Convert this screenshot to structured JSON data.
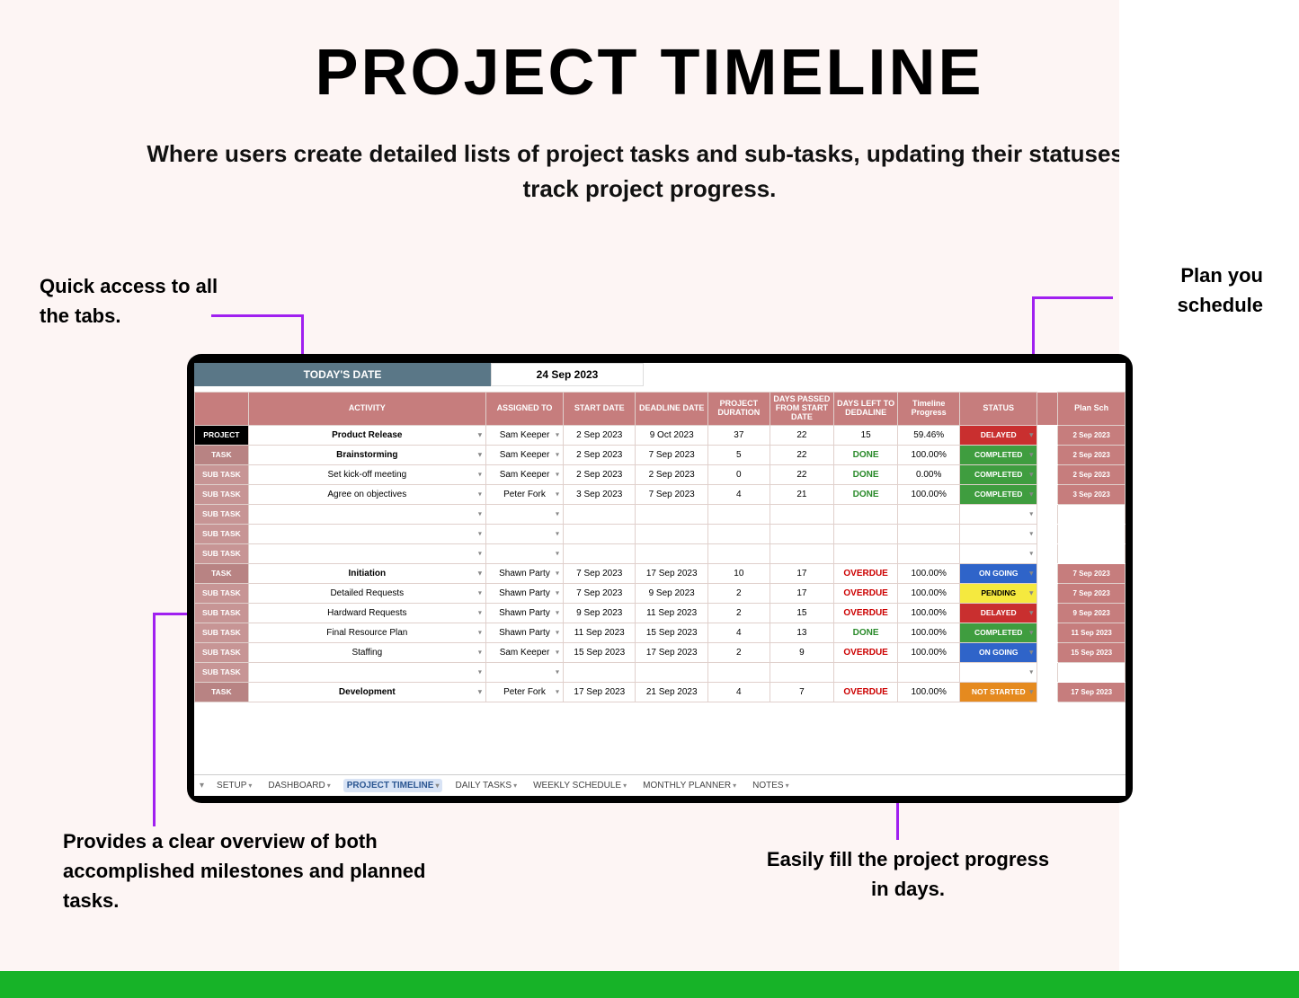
{
  "page_title": "PROJECT TIMELINE",
  "subtitle": "Where users create detailed lists of project tasks and sub-tasks, updating their statuses to track project progress.",
  "annotations": {
    "topleft": "Quick access to all the tabs.",
    "topright": "Plan you schedule",
    "bottomleft": "Provides a clear overview of both accomplished milestones and planned tasks.",
    "bottomright": "Easily fill the project progress in days."
  },
  "today_label": "TODAY'S DATE",
  "today_value": "24 Sep 2023",
  "columns": [
    "",
    "ACTIVITY",
    "ASSIGNED TO",
    "START DATE",
    "DEADLINE DATE",
    "PROJECT DURATION",
    "DAYS PASSED FROM START DATE",
    "DAYS LEFT TO DEDALINE",
    "Timeline Progress",
    "STATUS",
    "",
    "Plan Sch"
  ],
  "rows": [
    {
      "type": "PROJECT",
      "type_class": "rt-project",
      "bold": true,
      "activity": "Product Release",
      "assigned": "Sam Keeper",
      "start": "2 Sep 2023",
      "deadline": "9 Oct 2023",
      "duration": "37",
      "passed": "22",
      "left": "15",
      "left_class": "",
      "progress": "59.46%",
      "status": "DELAYED",
      "status_class": "st-delayed",
      "plan": "2 Sep 2023"
    },
    {
      "type": "TASK",
      "type_class": "rt-task",
      "bold": true,
      "activity": "Brainstorming",
      "assigned": "Sam Keeper",
      "start": "2 Sep 2023",
      "deadline": "7 Sep 2023",
      "duration": "5",
      "passed": "22",
      "left": "DONE",
      "left_class": "done",
      "progress": "100.00%",
      "status": "COMPLETED",
      "status_class": "st-completed",
      "plan": "2 Sep 2023"
    },
    {
      "type": "SUB TASK",
      "type_class": "rt-subtask",
      "activity": "Set kick-off meeting",
      "assigned": "Sam Keeper",
      "start": "2 Sep 2023",
      "deadline": "2 Sep 2023",
      "duration": "0",
      "passed": "22",
      "left": "DONE",
      "left_class": "done",
      "progress": "0.00%",
      "status": "COMPLETED",
      "status_class": "st-completed",
      "plan": "2 Sep 2023"
    },
    {
      "type": "SUB TASK",
      "type_class": "rt-subtask",
      "activity": "Agree on objectives",
      "assigned": "Peter Fork",
      "start": "3 Sep 2023",
      "deadline": "7 Sep 2023",
      "duration": "4",
      "passed": "21",
      "left": "DONE",
      "left_class": "done",
      "progress": "100.00%",
      "status": "COMPLETED",
      "status_class": "st-completed",
      "plan": "3 Sep 2023"
    },
    {
      "type": "SUB TASK",
      "type_class": "rt-subtask",
      "activity": "",
      "assigned": "",
      "start": "",
      "deadline": "",
      "duration": "",
      "passed": "",
      "left": "",
      "left_class": "",
      "progress": "",
      "status": "",
      "status_class": "",
      "plan": ""
    },
    {
      "type": "SUB TASK",
      "type_class": "rt-subtask",
      "activity": "",
      "assigned": "",
      "start": "",
      "deadline": "",
      "duration": "",
      "passed": "",
      "left": "",
      "left_class": "",
      "progress": "",
      "status": "",
      "status_class": "",
      "plan": ""
    },
    {
      "type": "SUB TASK",
      "type_class": "rt-subtask",
      "activity": "",
      "assigned": "",
      "start": "",
      "deadline": "",
      "duration": "",
      "passed": "",
      "left": "",
      "left_class": "",
      "progress": "",
      "status": "",
      "status_class": "",
      "plan": ""
    },
    {
      "type": "TASK",
      "type_class": "rt-task",
      "bold": true,
      "activity": "Initiation",
      "assigned": "Shawn Party",
      "start": "7 Sep 2023",
      "deadline": "17 Sep 2023",
      "duration": "10",
      "passed": "17",
      "left": "OVERDUE",
      "left_class": "overdue",
      "progress": "100.00%",
      "status": "ON GOING",
      "status_class": "st-ongoing",
      "plan": "7 Sep 2023"
    },
    {
      "type": "SUB TASK",
      "type_class": "rt-subtask",
      "activity": "Detailed Requests",
      "assigned": "Shawn Party",
      "start": "7 Sep 2023",
      "deadline": "9 Sep 2023",
      "duration": "2",
      "passed": "17",
      "left": "OVERDUE",
      "left_class": "overdue",
      "progress": "100.00%",
      "status": "PENDING",
      "status_class": "st-pending",
      "plan": "7 Sep 2023"
    },
    {
      "type": "SUB TASK",
      "type_class": "rt-subtask",
      "activity": "Hardward Requests",
      "assigned": "Shawn Party",
      "start": "9 Sep 2023",
      "deadline": "11 Sep 2023",
      "duration": "2",
      "passed": "15",
      "left": "OVERDUE",
      "left_class": "overdue",
      "progress": "100.00%",
      "status": "DELAYED",
      "status_class": "st-delayed",
      "plan": "9 Sep 2023"
    },
    {
      "type": "SUB TASK",
      "type_class": "rt-subtask",
      "activity": "Final Resource Plan",
      "assigned": "Shawn Party",
      "start": "11 Sep 2023",
      "deadline": "15 Sep 2023",
      "duration": "4",
      "passed": "13",
      "left": "DONE",
      "left_class": "done",
      "progress": "100.00%",
      "status": "COMPLETED",
      "status_class": "st-completed",
      "plan": "11 Sep 2023"
    },
    {
      "type": "SUB TASK",
      "type_class": "rt-subtask",
      "activity": "Staffing",
      "assigned": "Sam Keeper",
      "start": "15 Sep 2023",
      "deadline": "17 Sep 2023",
      "duration": "2",
      "passed": "9",
      "left": "OVERDUE",
      "left_class": "overdue",
      "progress": "100.00%",
      "status": "ON GOING",
      "status_class": "st-ongoing",
      "plan": "15 Sep 2023"
    },
    {
      "type": "SUB TASK",
      "type_class": "rt-subtask",
      "activity": "",
      "assigned": "",
      "start": "",
      "deadline": "",
      "duration": "",
      "passed": "",
      "left": "",
      "left_class": "",
      "progress": "",
      "status": "",
      "status_class": "",
      "plan": ""
    },
    {
      "type": "TASK",
      "type_class": "rt-task",
      "bold": true,
      "activity": "Development",
      "assigned": "Peter Fork",
      "start": "17 Sep 2023",
      "deadline": "21 Sep 2023",
      "duration": "4",
      "passed": "7",
      "left": "OVERDUE",
      "left_class": "overdue",
      "progress": "100.00%",
      "status": "NOT STARTED",
      "status_class": "st-notstarted",
      "plan": "17 Sep 2023"
    }
  ],
  "tabs": [
    "SETUP",
    "DASHBOARD",
    "PROJECT TIMELINE",
    "DAILY TASKS",
    "WEEKLY SCHEDULE",
    "MONTHLY PLANNER",
    "NOTES"
  ],
  "active_tab": 2
}
